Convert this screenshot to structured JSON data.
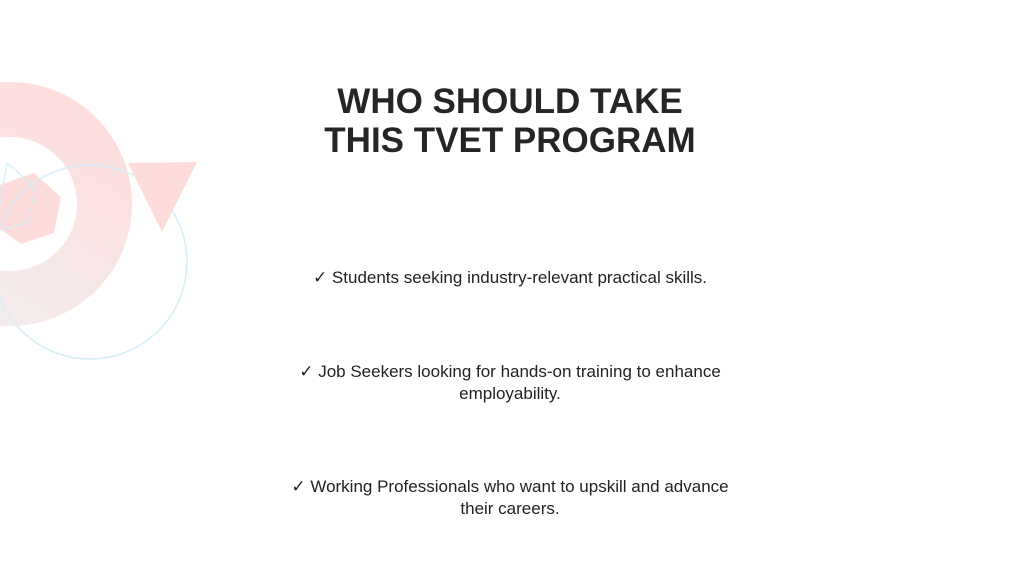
{
  "section": {
    "title": "WHO SHOULD TAKE THIS TVET PROGRAM",
    "check_glyph": "✓",
    "items": [
      {
        "text": "Students seeking industry-relevant practical skills."
      },
      {
        "text": "Job Seekers looking for hands-on training to enhance employability."
      },
      {
        "text": "Working Professionals who want to upskill and advance their careers."
      }
    ]
  },
  "colors": {
    "accent_pink": "#ffdcdc",
    "accent_blue": "#d6eef8"
  }
}
